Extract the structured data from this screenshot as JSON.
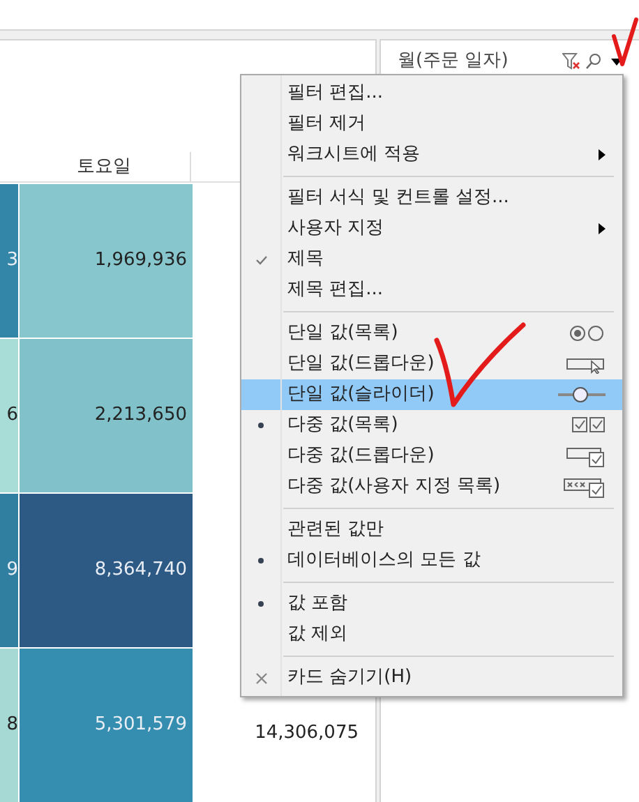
{
  "view": {
    "header": "토요일",
    "rows": [
      {
        "cells": [
          {
            "value": "3",
            "color": "#3386a8",
            "light": true
          },
          {
            "value": "1,969,936",
            "color": "#86c6cc",
            "light": false
          }
        ],
        "total": ""
      },
      {
        "cells": [
          {
            "value": "6",
            "color": "#a8dcd6",
            "light": false
          },
          {
            "value": "2,213,650",
            "color": "#80c1ca",
            "light": false
          }
        ],
        "total": ""
      },
      {
        "cells": [
          {
            "value": "9",
            "color": "#307ea0",
            "light": true
          },
          {
            "value": "8,364,740",
            "color": "#2d5a85",
            "light": true
          }
        ],
        "total": ""
      },
      {
        "cells": [
          {
            "value": "8",
            "color": "#a6d9d4",
            "light": false
          },
          {
            "value": "5,301,579",
            "color": "#358eb0",
            "light": true
          }
        ],
        "total": "14,306,075"
      }
    ]
  },
  "filter_card": {
    "title": "월(주문 일자)"
  },
  "menu": {
    "groups": [
      [
        {
          "kind": "action",
          "label": "필터 편집...",
          "hovered": false
        },
        {
          "kind": "action",
          "label": "필터 제거",
          "hovered": false
        },
        {
          "kind": "submenu",
          "label": "워크시트에 적용",
          "hovered": false
        }
      ],
      [
        {
          "kind": "action",
          "label": "필터 서식 및 컨트롤 설정...",
          "hovered": false
        },
        {
          "kind": "submenu",
          "label": "사용자 지정",
          "hovered": false
        },
        {
          "kind": "toggle",
          "label": "제목",
          "checked": true,
          "hovered": false
        },
        {
          "kind": "action",
          "label": "제목 편집...",
          "hovered": false
        }
      ],
      [
        {
          "kind": "radiolist",
          "label": "단일 값(목록)",
          "selected": false,
          "hovered": false
        },
        {
          "kind": "dropdown",
          "label": "단일 값(드롭다운)",
          "selected": false,
          "hovered": false
        },
        {
          "kind": "slider",
          "label": "단일 값(슬라이더)",
          "selected": false,
          "hovered": true
        },
        {
          "kind": "checklist",
          "label": "다중 값(목록)",
          "selected": true,
          "hovered": false
        },
        {
          "kind": "multidropdown",
          "label": "다중 값(드롭다운)",
          "selected": false,
          "hovered": false
        },
        {
          "kind": "customlist",
          "label": "다중 값(사용자 지정 목록)",
          "selected": false,
          "hovered": false
        }
      ],
      [
        {
          "kind": "radio",
          "label": "관련된 값만",
          "selected": false,
          "hovered": false
        },
        {
          "kind": "radio",
          "label": "데이터베이스의 모든 값",
          "selected": true,
          "hovered": false
        }
      ],
      [
        {
          "kind": "radio",
          "label": "값 포함",
          "selected": true,
          "hovered": false
        },
        {
          "kind": "radio",
          "label": "값 제외",
          "selected": false,
          "hovered": false
        }
      ],
      [
        {
          "kind": "close",
          "label": "카드 숨기기(H)",
          "hovered": false
        }
      ]
    ]
  }
}
